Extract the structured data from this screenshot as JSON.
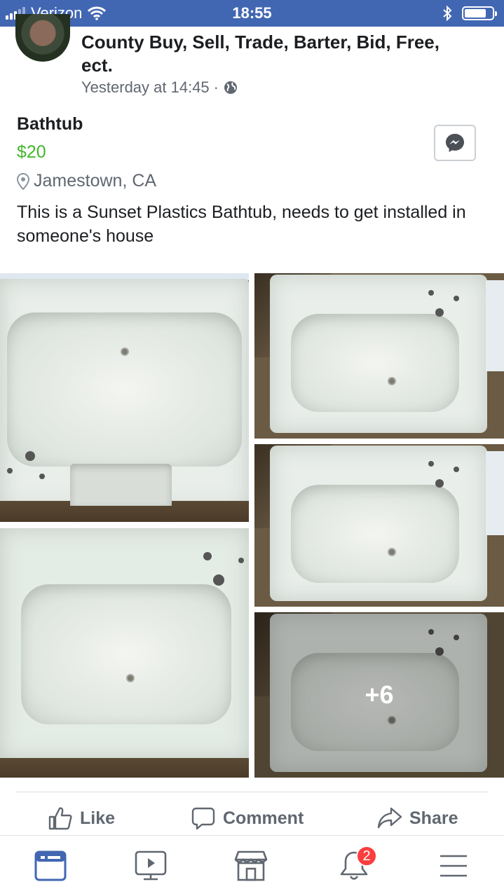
{
  "status_bar": {
    "carrier": "Verizon",
    "time": "18:55"
  },
  "post": {
    "group_name": "County Buy, Sell, Trade, Barter, Bid, Free, ect.",
    "timestamp": "Yesterday at 14:45",
    "separator": "·",
    "listing": {
      "title": "Bathtub",
      "price": "$20",
      "location": "Jamestown, CA",
      "description": "This is a Sunset Plastics Bathtub, needs to get installed in someone's house"
    },
    "more_photos": "+6"
  },
  "actions": {
    "like": "Like",
    "comment": "Comment",
    "share": "Share"
  },
  "nav": {
    "items": [
      "news-feed",
      "watch",
      "marketplace",
      "notifications",
      "menu"
    ],
    "notification_count": "2"
  },
  "colors": {
    "brand": "#4267b2",
    "price": "#42b72a",
    "badge": "#fa3e3e",
    "active_nav": "#4267b2"
  }
}
